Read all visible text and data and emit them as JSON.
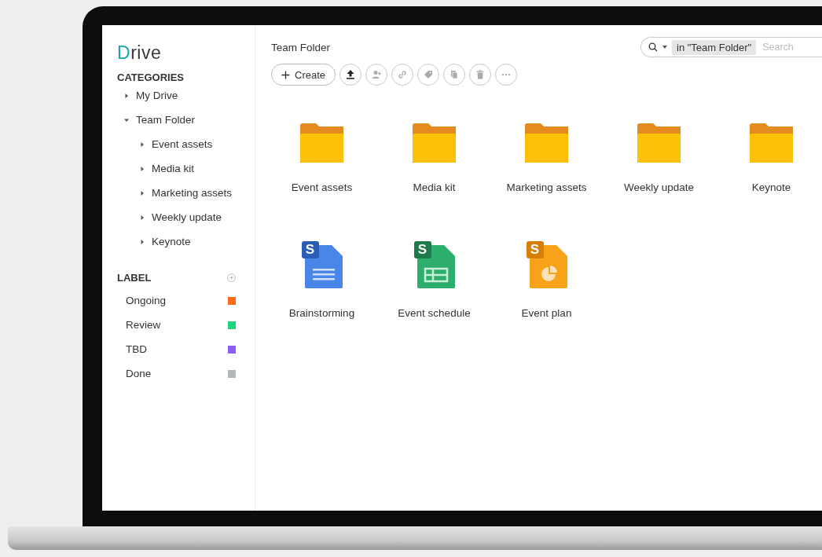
{
  "app": {
    "logo": "Drive"
  },
  "sidebar": {
    "categories_heading": "CATEGORIES",
    "tree": [
      {
        "label": "My Drive",
        "expanded": false
      },
      {
        "label": "Team Folder",
        "expanded": true,
        "children": [
          {
            "label": "Event assets",
            "expanded": false
          },
          {
            "label": "Media kit",
            "expanded": false
          },
          {
            "label": "Marketing assets",
            "expanded": false
          },
          {
            "label": "Weekly update",
            "expanded": false
          },
          {
            "label": "Keynote",
            "expanded": false
          }
        ]
      }
    ],
    "label_heading": "LABEL",
    "labels": [
      {
        "name": "Ongoing",
        "color": "#ff6a13"
      },
      {
        "name": "Review",
        "color": "#1fd47e"
      },
      {
        "name": "TBD",
        "color": "#8e5cf7"
      },
      {
        "name": "Done",
        "color": "#b4b6bd"
      }
    ]
  },
  "main": {
    "breadcrumb": "Team Folder",
    "create_button": "Create",
    "toolbar": [
      {
        "kind": "upload"
      },
      {
        "kind": "share"
      },
      {
        "kind": "link"
      },
      {
        "kind": "tag"
      },
      {
        "kind": "copy"
      },
      {
        "kind": "delete"
      },
      {
        "kind": "more"
      }
    ],
    "search": {
      "scope": "in \"Team Folder\"",
      "placeholder": "Search"
    },
    "items": [
      {
        "kind": "folder",
        "name": "Event assets"
      },
      {
        "kind": "folder",
        "name": "Media kit"
      },
      {
        "kind": "folder",
        "name": "Marketing assets"
      },
      {
        "kind": "folder",
        "name": "Weekly update"
      },
      {
        "kind": "folder",
        "name": "Keynote"
      },
      {
        "kind": "doc",
        "badge": "S",
        "name": "Brainstorming"
      },
      {
        "kind": "sheet",
        "badge": "S",
        "name": "Event schedule"
      },
      {
        "kind": "slides",
        "badge": "S",
        "name": "Event plan"
      }
    ]
  }
}
